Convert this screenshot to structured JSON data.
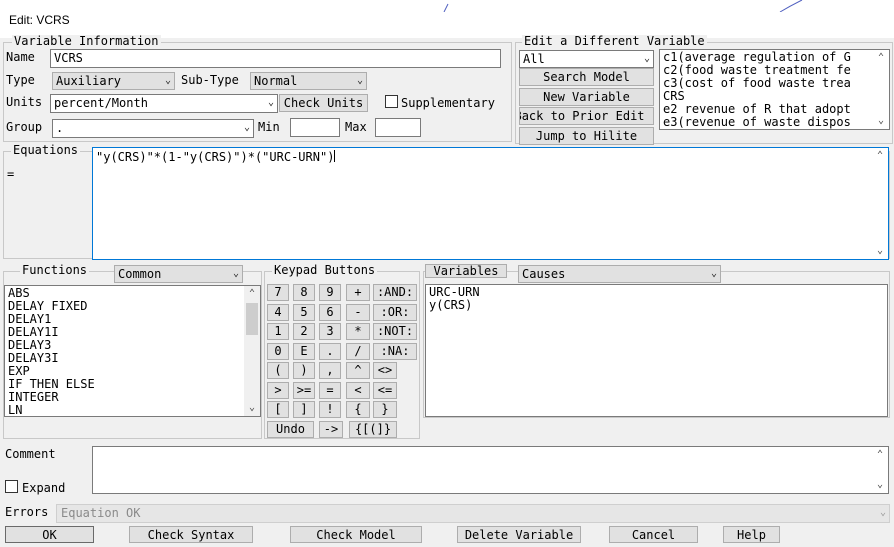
{
  "window": {
    "title": "Edit: VCRS"
  },
  "variable_info": {
    "section_label": "Variable Information",
    "name_label": "Name",
    "name_value": "VCRS",
    "type_label": "Type",
    "type_value": "Auxiliary",
    "subtype_label": "Sub-Type",
    "subtype_value": "Normal",
    "units_label": "Units",
    "units_value": "percent/Month",
    "check_units_label": "Check Units",
    "supplementary_label": "Supplementary",
    "group_label": "Group",
    "group_value": ".",
    "min_label": "Min",
    "min_value": "",
    "max_label": "Max",
    "max_value": ""
  },
  "edit_different": {
    "section_label": "Edit a Different Variable",
    "filter_value": "All",
    "search_model_label": "Search Model",
    "new_variable_label": "New Variable",
    "back_label": "Back to Prior Edit",
    "jump_label": "Jump to Hilite",
    "variables": [
      "c1(average regulation of G",
      "c2(food waste treatment fe",
      "c3(cost of food waste trea",
      "CRS",
      "e2 revenue of R that adopt",
      "e3(revenue of waste dispos"
    ]
  },
  "equations": {
    "label": "Equations",
    "equals": "=",
    "value": "\"y(CRS)\"*(1-\"y(CRS)\")*(\"URC-URN\")"
  },
  "functions": {
    "label": "Functions",
    "category": "Common",
    "items": [
      "ABS",
      "DELAY FIXED",
      "DELAY1",
      "DELAY1I",
      "DELAY3",
      "DELAY3I",
      "EXP",
      "IF THEN ELSE",
      "INTEGER",
      "LN"
    ]
  },
  "keypad": {
    "label": "Keypad Buttons",
    "rows": [
      [
        "7",
        "8",
        "9",
        "+",
        ":AND:"
      ],
      [
        "4",
        "5",
        "6",
        "-",
        ":OR:"
      ],
      [
        "1",
        "2",
        "3",
        "*",
        ":NOT:"
      ],
      [
        "0",
        "E",
        ".",
        "/",
        ":NA:"
      ],
      [
        "(",
        ")",
        ",",
        "^",
        "<>"
      ],
      [
        ">",
        ">=",
        "=",
        "<",
        "<="
      ],
      [
        "[",
        "]",
        "!",
        "{",
        "}"
      ]
    ],
    "undo_label": "Undo",
    "arrow_label": "->",
    "brackets_label": "{[(]}"
  },
  "variables_panel": {
    "button_label": "Variables",
    "mode": "Causes",
    "items": [
      "URC-URN",
      "y(CRS)"
    ]
  },
  "comment": {
    "label": "Comment",
    "value": "",
    "expand_label": "Expand"
  },
  "errors": {
    "label": "Errors",
    "value": "Equation OK"
  },
  "bottom_buttons": {
    "ok": "OK",
    "check_syntax": "Check Syntax",
    "check_model": "Check Model",
    "delete_variable": "Delete Variable",
    "cancel": "Cancel",
    "help": "Help"
  }
}
